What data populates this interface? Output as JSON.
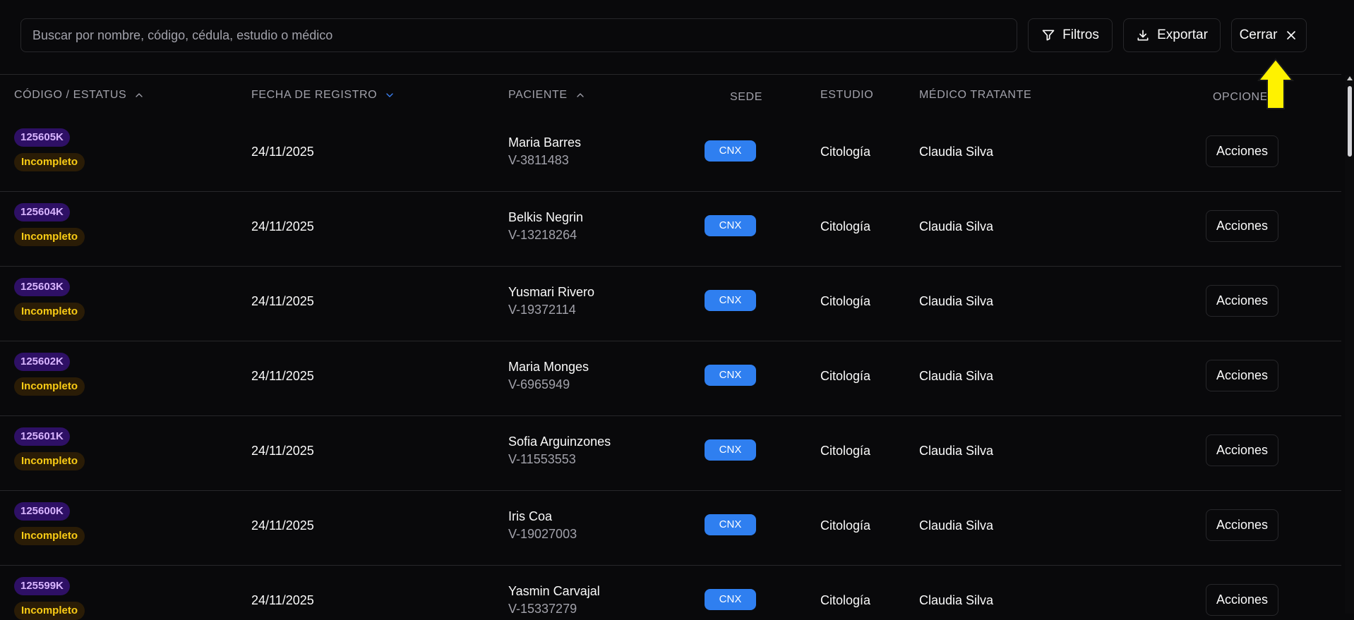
{
  "search": {
    "placeholder": "Buscar por nombre, código, cédula, estudio o médico"
  },
  "toolbar": {
    "filtros": "Filtros",
    "exportar": "Exportar",
    "cerrar": "Cerrar"
  },
  "columns": {
    "codigo": "CÓDIGO / ESTATUS",
    "fecha": "FECHA DE REGISTRO",
    "paciente": "PACIENTE",
    "sede": "SEDE",
    "estudio": "ESTUDIO",
    "medico": "MÉDICO TRATANTE",
    "opciones": "OPCIONES"
  },
  "colors": {
    "accent": "#2f7ff0",
    "code_badge_bg": "#2e1065",
    "code_badge_text": "#d8b4fe",
    "status_bg": "#2a1c06",
    "status_text": "#facc15",
    "pointer": "#fff200"
  },
  "rows": [
    {
      "code": "125605K",
      "status": "Incompleto",
      "date": "24/11/2025",
      "name": "Maria Barres",
      "id": "V-3811483",
      "sede": "CNX",
      "estudio": "Citología",
      "medico": "Claudia Silva",
      "action": "Acciones"
    },
    {
      "code": "125604K",
      "status": "Incompleto",
      "date": "24/11/2025",
      "name": "Belkis Negrin",
      "id": "V-13218264",
      "sede": "CNX",
      "estudio": "Citología",
      "medico": "Claudia Silva",
      "action": "Acciones"
    },
    {
      "code": "125603K",
      "status": "Incompleto",
      "date": "24/11/2025",
      "name": "Yusmari Rivero",
      "id": "V-19372114",
      "sede": "CNX",
      "estudio": "Citología",
      "medico": "Claudia Silva",
      "action": "Acciones"
    },
    {
      "code": "125602K",
      "status": "Incompleto",
      "date": "24/11/2025",
      "name": "Maria Monges",
      "id": "V-6965949",
      "sede": "CNX",
      "estudio": "Citología",
      "medico": "Claudia Silva",
      "action": "Acciones"
    },
    {
      "code": "125601K",
      "status": "Incompleto",
      "date": "24/11/2025",
      "name": "Sofia Arguinzones",
      "id": "V-11553553",
      "sede": "CNX",
      "estudio": "Citología",
      "medico": "Claudia Silva",
      "action": "Acciones"
    },
    {
      "code": "125600K",
      "status": "Incompleto",
      "date": "24/11/2025",
      "name": "Iris Coa",
      "id": "V-19027003",
      "sede": "CNX",
      "estudio": "Citología",
      "medico": "Claudia Silva",
      "action": "Acciones"
    },
    {
      "code": "125599K",
      "status": "Incompleto",
      "date": "24/11/2025",
      "name": "Yasmin Carvajal",
      "id": "V-15337279",
      "sede": "CNX",
      "estudio": "Citología",
      "medico": "Claudia Silva",
      "action": "Acciones"
    }
  ]
}
